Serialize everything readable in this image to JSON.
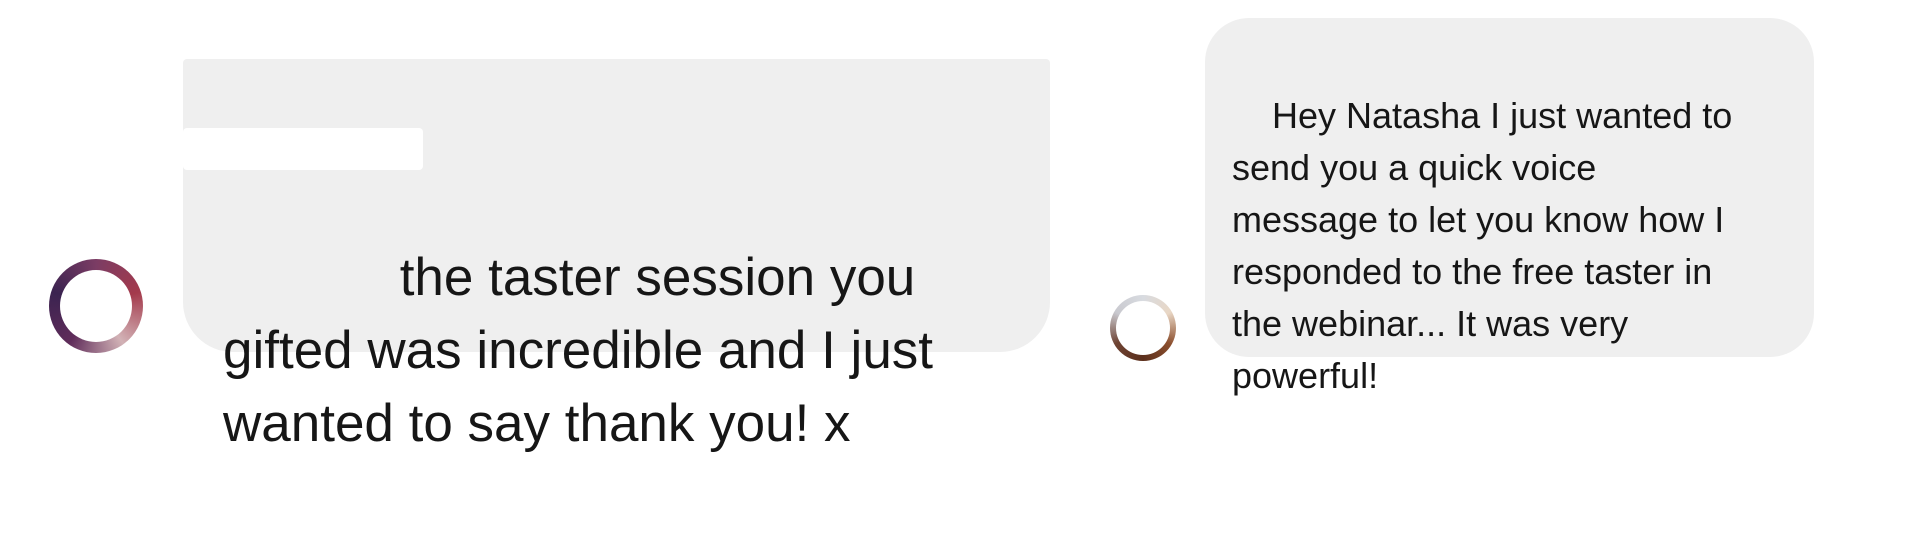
{
  "messages": [
    {
      "id": "msg-1",
      "text": "        the taster session you\ngifted was incredible and I just\nwanted to say thank you! x",
      "redacted_prefix": true
    },
    {
      "id": "msg-2",
      "text": "Hey Natasha I just wanted to\nsend you a quick voice\nmessage to let you know how I\nresponded to the free taster in\nthe webinar... It was very\npowerful!"
    }
  ],
  "colors": {
    "bubble_background": "#efefef",
    "text": "#161616",
    "page_background": "#ffffff"
  },
  "icons": {
    "avatar_1": "avatar-ring-purple",
    "avatar_2": "avatar-ring-brown"
  }
}
